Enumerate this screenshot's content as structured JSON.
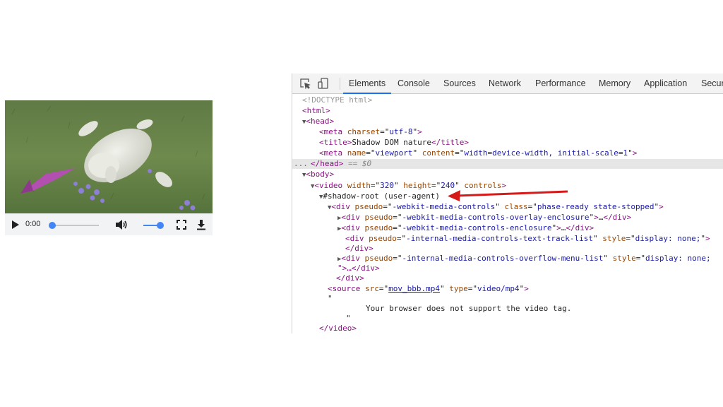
{
  "player": {
    "time": "0:00",
    "progress_fraction": 0.0,
    "volume_fraction": 1.0,
    "icons": [
      "play-icon",
      "volume-icon",
      "fullscreen-icon",
      "download-icon"
    ]
  },
  "devtools": {
    "tabs": [
      "Elements",
      "Console",
      "Sources",
      "Network",
      "Performance",
      "Memory",
      "Application",
      "Secur"
    ],
    "active_tab": "Elements",
    "dom": {
      "doctype": "<!DOCTYPE html>",
      "html_tag": "html",
      "head_tag": "head",
      "meta1": {
        "tag": "meta",
        "attr": "charset",
        "val": "utf-8"
      },
      "title": {
        "tag": "title",
        "text": "Shadow DOM nature"
      },
      "meta2": {
        "tag": "meta",
        "attr1": "name",
        "val1": "viewport",
        "attr2": "content",
        "val2": "width=device-width, initial-scale=1"
      },
      "head_close": "</head>",
      "selected_marker": "== $0",
      "body_tag": "body",
      "video": {
        "tag": "video",
        "attr1": "width",
        "val1": "320",
        "attr2": "height",
        "val2": "240",
        "attr3": "controls"
      },
      "shadow_root": "#shadow-root (user-agent)",
      "div_controls": {
        "tag": "div",
        "attr1": "pseudo",
        "val1": "-webkit-media-controls",
        "attr2": "class",
        "val2": "phase-ready state-stopped"
      },
      "div_overlay": {
        "tag": "div",
        "attr": "pseudo",
        "val": "-webkit-media-controls-overlay-enclosure"
      },
      "div_enclosure": {
        "tag": "div",
        "attr": "pseudo",
        "val": "-webkit-media-controls-enclosure"
      },
      "div_text_track": {
        "tag": "div",
        "attr1": "pseudo",
        "val1": "-internal-media-controls-text-track-list",
        "attr2": "style",
        "val2": "display: none;"
      },
      "div_close": "</div>",
      "div_overflow": {
        "tag": "div",
        "attr1": "pseudo",
        "val1": "-internal-media-controls-overflow-menu-list",
        "attr2": "style",
        "val2": "display: none;"
      },
      "overflow_cont": "\">…</div>",
      "source": {
        "tag": "source",
        "attr1": "src",
        "val1": "mov_bbb.mp4",
        "attr2": "type",
        "val2": "video/mp4"
      },
      "quote_open": "\"",
      "fallback_text": "Your browser does not support the video tag.",
      "quote_close": "\"",
      "video_close": "</video>",
      "ellipsis": "…",
      "row_dots": "..."
    }
  },
  "colors": {
    "tag": "#881280",
    "attr": "#994500",
    "value": "#1a1aa6",
    "accent": "#1a73e8",
    "player_blue": "#4285f4",
    "arrow": "#d61a1a"
  }
}
